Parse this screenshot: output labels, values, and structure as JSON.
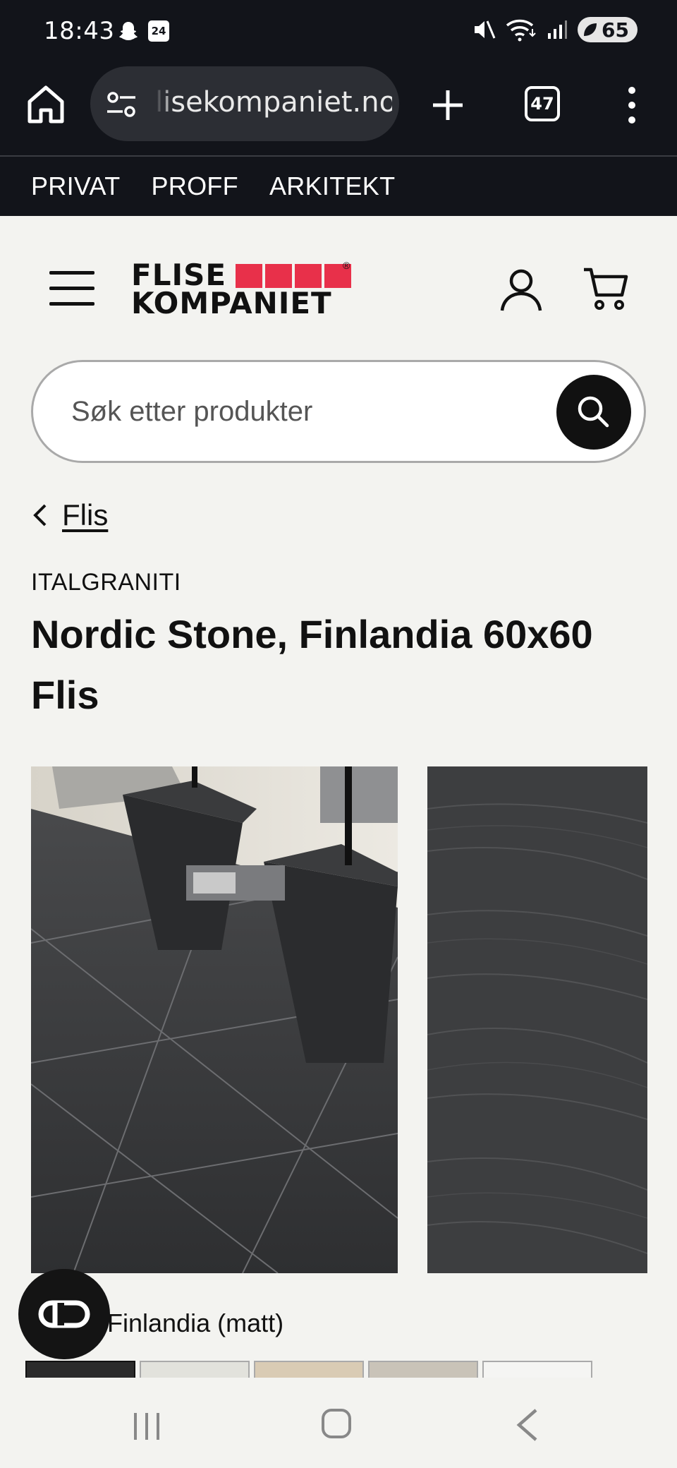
{
  "status_bar": {
    "time": "18:43",
    "calendar_badge": "24",
    "battery": "65"
  },
  "browser": {
    "url": "flisekompaniet.no",
    "url_visible": "lisekompaniet.no",
    "tabs_count": "47"
  },
  "segment_nav": {
    "items": [
      "PRIVAT",
      "PROFF",
      "ARKITEKT"
    ]
  },
  "logo": {
    "line1": "FLISE",
    "line2": "KOMPANIET",
    "reg": "®",
    "accent_color": "#e8304a"
  },
  "search": {
    "placeholder": "Søk etter produkter"
  },
  "breadcrumb": {
    "label": "Flis"
  },
  "product": {
    "brand": "ITALGRANITI",
    "title": "Nordic Stone, Finlandia 60x60 Flis",
    "variant_label": "Finlandia (matt)",
    "swatch_colors": [
      "#2b2b2b",
      "#e2e2dc",
      "#d9cbb4",
      "#c9c3b8",
      "#f5f5f3"
    ]
  },
  "icons": {
    "browser_home": "home-icon",
    "site_settings": "tune-icon",
    "new_tab": "plus-icon",
    "menu": "more-vertical-icon",
    "hamburger": "menu-icon",
    "account": "user-icon",
    "cart": "cart-icon",
    "search": "search-icon",
    "back": "chevron-left-icon",
    "compare": "link-icon"
  }
}
